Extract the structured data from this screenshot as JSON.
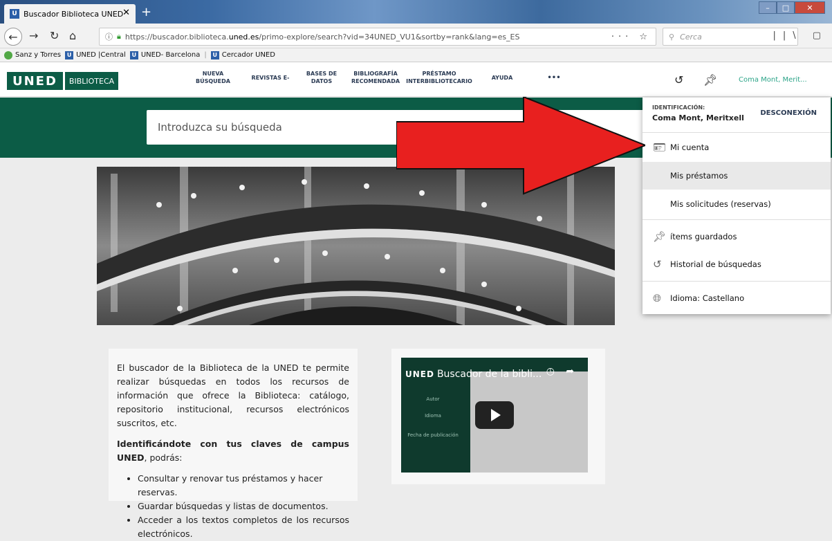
{
  "browser": {
    "tab_title": "Buscador Biblioteca UNED",
    "tab_close": "✕",
    "new_tab": "+",
    "url_prefix": "https://buscador.biblioteca.",
    "url_domain": "uned.es",
    "url_rest": "/primo-explore/search?vid=34UNED_VU1&sortby=rank&lang=es_ES",
    "search_placeholder": "Cerca",
    "bookmarks": [
      "Sanz y Torres",
      "UNED |Central",
      "UNED- Barcelona",
      "Cercador UNED"
    ]
  },
  "site": {
    "logo_text": "UNED",
    "logo_sub": "BIBLIOTECA",
    "menu": [
      {
        "line1": "NUEVA",
        "line2": "BÚSQUEDA"
      },
      {
        "line1": "REVISTAS E-",
        "line2": ""
      },
      {
        "line1": "BASES DE",
        "line2": "DATOS"
      },
      {
        "line1": "BIBLIOGRAFÍA",
        "line2": "RECOMENDADA"
      },
      {
        "line1": "PRÉSTAMO",
        "line2": "INTERBIBLIOTECARIO"
      },
      {
        "line1": "AYUDA",
        "line2": ""
      },
      {
        "line1": "•••",
        "line2": ""
      }
    ],
    "user_short": "Coma Mont, Merit...",
    "search_placeholder": "Introduzca su búsqueda"
  },
  "dropdown": {
    "heading": "IDENTIFICACIÓN:",
    "name": "Coma Mont, Meritxell",
    "logout": "DESCONEXIÓN",
    "account": "Mi cuenta",
    "loans": "Mis préstamos",
    "requests": "Mis solicitudes (reservas)",
    "saved": "ítems guardados",
    "history": "Historial de búsquedas",
    "language": "Idioma: Castellano"
  },
  "info": {
    "para1": "El buscador de la Biblioteca de la UNED te permite realizar búsquedas en todos los recursos de información que ofrece la Biblioteca: catálogo, repositorio institucional, recursos electrónicos suscritos, etc.",
    "para2_bold": "Identificándote con tus claves de campus UNED",
    "para2_rest": ", podrás:",
    "bullets": [
      "Consultar y renovar tus préstamos y hacer reservas.",
      "Guardar búsquedas y listas de documentos.",
      "Acceder a los textos completos de los recursos electrónicos."
    ]
  },
  "video": {
    "brand": "UNED",
    "title": "Buscador de la bibli...",
    "side": [
      "Autor",
      "Idioma",
      "Fecha de publicación"
    ]
  },
  "colors": {
    "uned_green": "#0c5c46",
    "user_link": "#2ca488",
    "arrow_red": "#e8201f"
  }
}
